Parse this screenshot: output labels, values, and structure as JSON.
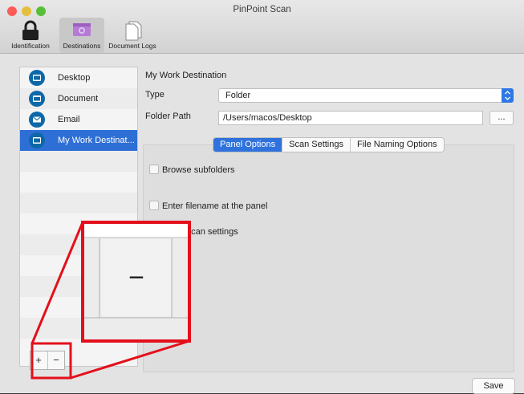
{
  "window": {
    "title": "PinPoint Scan"
  },
  "toolbar": {
    "items": [
      {
        "label": "Identification",
        "icon": "lock-icon"
      },
      {
        "label": "Destinations",
        "icon": "destination-icon"
      },
      {
        "label": "Document Logs",
        "icon": "document-logs-icon"
      }
    ],
    "selected": "Destinations"
  },
  "sidebar": {
    "items": [
      {
        "label": "Desktop",
        "icon": "desktop-icon"
      },
      {
        "label": "Document",
        "icon": "folder-icon"
      },
      {
        "label": "Email",
        "icon": "email-icon"
      },
      {
        "label": "My Work Destinat...",
        "icon": "desktop-icon",
        "selected": true
      }
    ],
    "add_label": "+",
    "remove_label": "−"
  },
  "destination": {
    "name": "My Work Destination",
    "type_label": "Type",
    "type_value": "Folder",
    "path_label": "Folder Path",
    "path_value": "/Users/macos/Desktop",
    "browse_label": "..."
  },
  "tabs": [
    {
      "label": "Panel Options",
      "active": true
    },
    {
      "label": "Scan Settings",
      "active": false
    },
    {
      "label": "File Naming Options",
      "active": false
    }
  ],
  "options": [
    {
      "label": "Browse subfolders",
      "checked": false
    },
    {
      "label": "Enter filename at the panel",
      "checked": false
    },
    {
      "label": "Show scan settings",
      "checked": false
    }
  ],
  "footer": {
    "save_label": "Save"
  },
  "zoom_callout": {
    "label": "−"
  },
  "colors": {
    "selection": "#2e6fd5",
    "highlight_box": "#e3101b",
    "close": "#fc5b57",
    "minimize": "#e5bf3c",
    "zoom": "#57c038"
  }
}
